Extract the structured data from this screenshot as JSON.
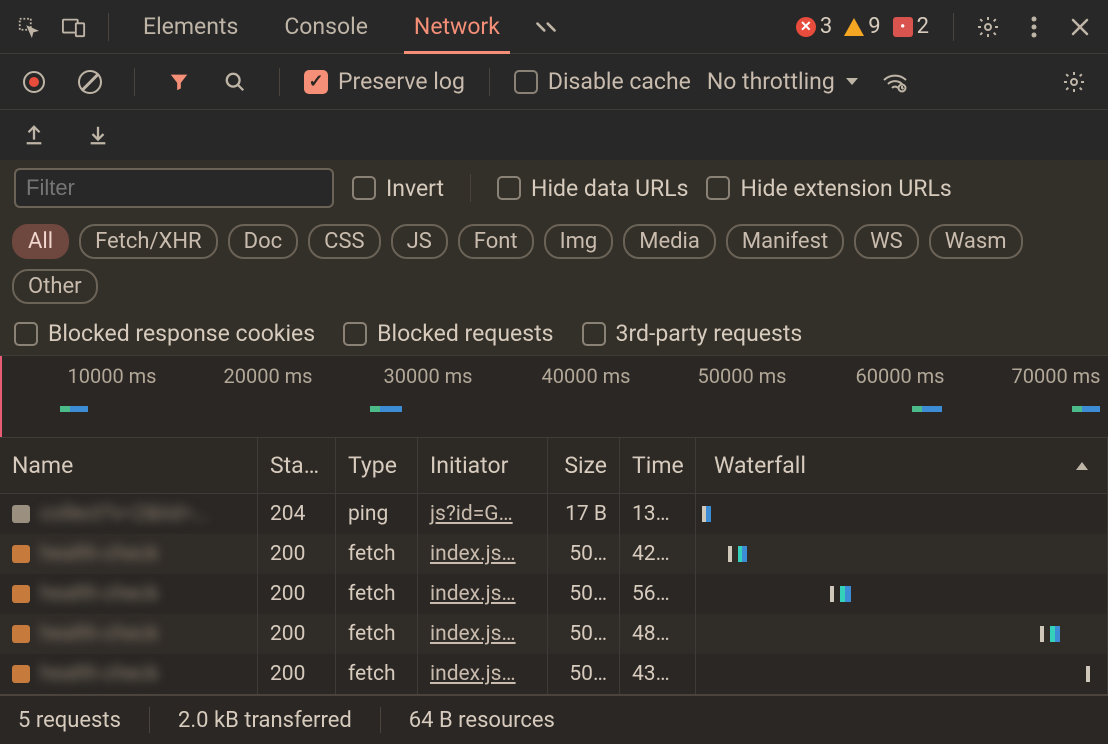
{
  "tabs": {
    "elements": "Elements",
    "console": "Console",
    "network": "Network"
  },
  "status": {
    "errors": "3",
    "warnings": "9",
    "issues": "2"
  },
  "toolbar": {
    "preserve_log": "Preserve log",
    "disable_cache": "Disable cache",
    "throttling": "No throttling"
  },
  "filters": {
    "placeholder": "Filter",
    "invert": "Invert",
    "hide_data": "Hide data URLs",
    "hide_ext": "Hide extension URLs"
  },
  "types": {
    "all": "All",
    "fetch": "Fetch/XHR",
    "doc": "Doc",
    "css": "CSS",
    "js": "JS",
    "font": "Font",
    "img": "Img",
    "media": "Media",
    "manifest": "Manifest",
    "ws": "WS",
    "wasm": "Wasm",
    "other": "Other"
  },
  "block": {
    "cookies": "Blocked response cookies",
    "requests": "Blocked requests",
    "third": "3rd-party requests"
  },
  "timeline": {
    "ticks": [
      "10000 ms",
      "20000 ms",
      "30000 ms",
      "40000 ms",
      "50000 ms",
      "60000 ms",
      "70000 ms"
    ]
  },
  "columns": {
    "name": "Name",
    "status": "Sta…",
    "type": "Type",
    "initiator": "Initiator",
    "size": "Size",
    "time": "Time",
    "waterfall": "Waterfall"
  },
  "rows": [
    {
      "name": "collect?v=2&tid=…",
      "icon": "#9b9080",
      "status": "204",
      "type": "ping",
      "initiator": "js?id=G…",
      "size": "17 B",
      "time": "13…"
    },
    {
      "name": "health-check",
      "icon": "#c67b3d",
      "status": "200",
      "type": "fetch",
      "initiator": "index.js…",
      "size": "50…",
      "time": "42…"
    },
    {
      "name": "health-check",
      "icon": "#c67b3d",
      "status": "200",
      "type": "fetch",
      "initiator": "index.js…",
      "size": "50…",
      "time": "56…"
    },
    {
      "name": "health-check",
      "icon": "#c67b3d",
      "status": "200",
      "type": "fetch",
      "initiator": "index.js…",
      "size": "50…",
      "time": "48…"
    },
    {
      "name": "health-check",
      "icon": "#c67b3d",
      "status": "200",
      "type": "fetch",
      "initiator": "index.js…",
      "size": "50…",
      "time": "43…"
    }
  ],
  "footer": {
    "requests": "5 requests",
    "transferred": "2.0 kB transferred",
    "resources": "64 B resources"
  }
}
